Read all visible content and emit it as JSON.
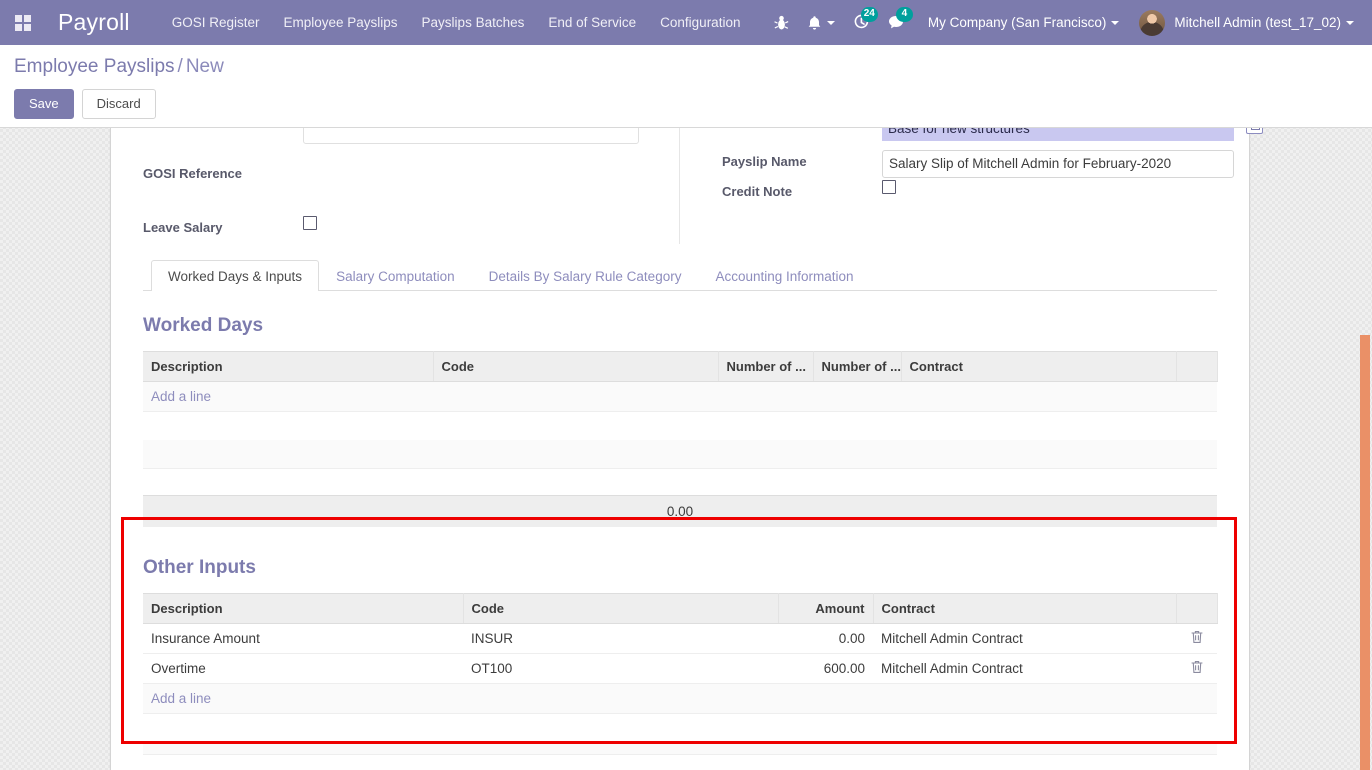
{
  "navbar": {
    "apps_icon": "apps-grid-icon",
    "brand": "Payroll",
    "menu_items": [
      {
        "label": "GOSI Register"
      },
      {
        "label": "Employee Payslips"
      },
      {
        "label": "Payslips Batches"
      },
      {
        "label": "End of Service"
      },
      {
        "label": "Configuration"
      }
    ],
    "bug_icon": "bug-icon",
    "bell_icon": "bell-icon",
    "activity_icon": "clock-activity-icon",
    "activity_count": "24",
    "messages_icon": "chat-bubble-icon",
    "messages_count": "4",
    "company": "My Company (San Francisco)",
    "user": "Mitchell Admin (test_17_02)",
    "avatar_icon": "user-avatar",
    "accent_color": "#7c7bad",
    "badge_color": "#00a09d"
  },
  "control_panel": {
    "breadcrumb_root": "Employee Payslips",
    "breadcrumb_sep": "/",
    "breadcrumb_current": "New",
    "save_label": "Save",
    "discard_label": "Discard"
  },
  "form": {
    "left": {
      "gosi_reference_label": "GOSI Reference",
      "gosi_reference_value": "",
      "leave_salary_label": "Leave Salary",
      "leave_salary_checked": false,
      "top_input_value": ""
    },
    "right": {
      "structure_value": "Base for new structures",
      "payslip_name_label": "Payslip Name",
      "payslip_name_value": "Salary Slip of Mitchell Admin for February-2020",
      "credit_note_label": "Credit Note",
      "credit_note_checked": false,
      "external_link_icon": "external-link-icon"
    }
  },
  "notebook": {
    "tabs": [
      {
        "label": "Worked Days & Inputs",
        "active": true
      },
      {
        "label": "Salary Computation",
        "active": false
      },
      {
        "label": "Details By Salary Rule Category",
        "active": false
      },
      {
        "label": "Accounting Information",
        "active": false
      }
    ]
  },
  "worked_days": {
    "title": "Worked Days",
    "columns": [
      "Description",
      "Code",
      "Number of ...",
      "Number of ...",
      "Contract"
    ],
    "rows": [],
    "add_line_label": "Add a line",
    "total": "0.00"
  },
  "other_inputs": {
    "title": "Other Inputs",
    "columns": [
      "Description",
      "Code",
      "Amount",
      "Contract"
    ],
    "rows": [
      {
        "description": "Insurance Amount",
        "code": "INSUR",
        "amount": "0.00",
        "contract": "Mitchell Admin Contract",
        "delete_icon": "trash-icon"
      },
      {
        "description": "Overtime",
        "code": "OT100",
        "amount": "600.00",
        "contract": "Mitchell Admin Contract",
        "delete_icon": "trash-icon"
      }
    ],
    "add_line_label": "Add a line"
  },
  "annotation": {
    "highlight_color": "#ee0000"
  },
  "scrollbar": {
    "thumb_color": "#ea9067"
  }
}
